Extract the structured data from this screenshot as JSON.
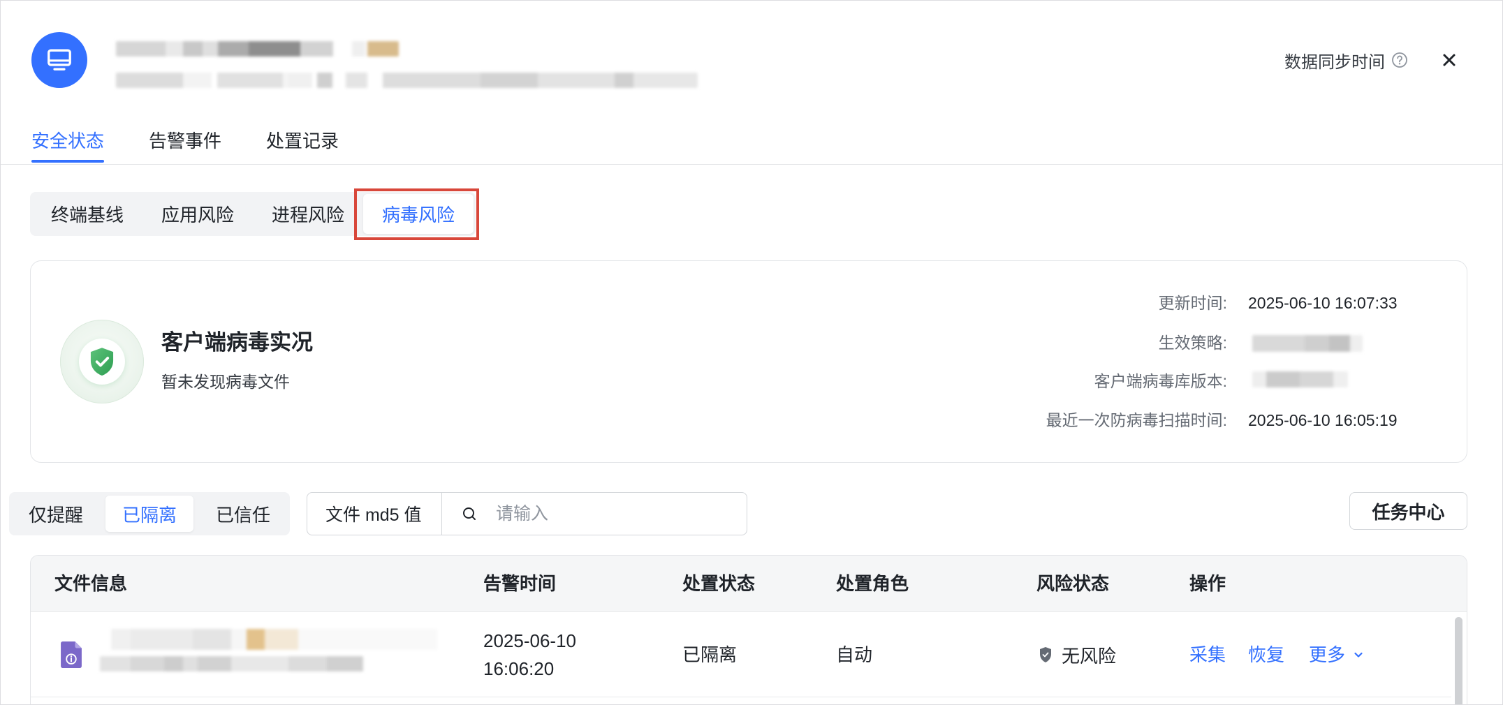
{
  "header": {
    "avatar_icon": "monitor-icon",
    "sync_time_label": "数据同步时间",
    "help_icon": "question-circle-icon",
    "close_icon": "close-icon"
  },
  "tabs": [
    {
      "label": "安全状态",
      "active": true
    },
    {
      "label": "告警事件",
      "active": false
    },
    {
      "label": "处置记录",
      "active": false
    }
  ],
  "sub_tabs": [
    {
      "label": "终端基线",
      "active": false
    },
    {
      "label": "应用风险",
      "active": false
    },
    {
      "label": "进程风险",
      "active": false
    },
    {
      "label": "病毒风险",
      "active": true,
      "highlighted": true
    }
  ],
  "virus_summary": {
    "icon": "shield-check-icon",
    "title": "客户端病毒实况",
    "subtitle": "暂未发现病毒文件",
    "fields": [
      {
        "label": "更新时间:",
        "value": "2025-06-10 16:07:33"
      },
      {
        "label": "生效策略:",
        "redacted": true
      },
      {
        "label": "客户端病毒库版本:",
        "redacted": true
      },
      {
        "label": "最近一次防病毒扫描时间:",
        "value": "2025-06-10 16:05:19"
      }
    ]
  },
  "filters": {
    "status_options": [
      {
        "label": "仅提醒",
        "active": false
      },
      {
        "label": "已隔离",
        "active": true
      },
      {
        "label": "已信任",
        "active": false
      }
    ],
    "search_field": "文件 md5 值",
    "search_icon": "search-icon",
    "search_placeholder": "请输入",
    "search_value": "",
    "task_center_label": "任务中心"
  },
  "table": {
    "columns": [
      "文件信息",
      "告警时间",
      "处置状态",
      "处置角色",
      "风险状态",
      "操作"
    ],
    "rows": [
      {
        "file_icon": "file-info-icon",
        "file_name_redacted": true,
        "alert_time": "2025-06-10 16:06:20",
        "status": "已隔离",
        "role": "自动",
        "risk_icon": "shield-check-icon",
        "risk": "无风险",
        "actions": [
          "采集",
          "恢复",
          "更多"
        ],
        "more_icon": "chevron-down-icon"
      }
    ]
  },
  "colors": {
    "accent": "#3370ff",
    "highlight_box": "#d8473a",
    "safe_green": "#34a853",
    "file_icon": "#7b68c9",
    "text": "#1f2329",
    "muted": "#646a73"
  }
}
